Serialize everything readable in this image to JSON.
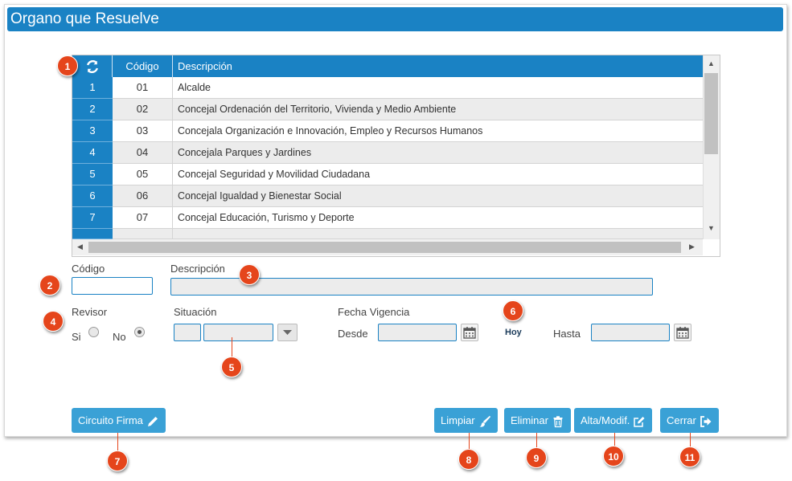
{
  "window": {
    "title": "Organo que Resuelve"
  },
  "grid": {
    "columns": {
      "refresh_icon": "refresh-icon",
      "code": "Código",
      "description": "Descripción"
    },
    "rows": [
      {
        "num": "1",
        "code": "01",
        "description": "Alcalde"
      },
      {
        "num": "2",
        "code": "02",
        "description": "Concejal Ordenación del Territorio, Vivienda y Medio Ambiente"
      },
      {
        "num": "3",
        "code": "03",
        "description": "Concejala Organización e Innovación, Empleo y Recursos Humanos"
      },
      {
        "num": "4",
        "code": "04",
        "description": "Concejala Parques y Jardines"
      },
      {
        "num": "5",
        "code": "05",
        "description": "Concejal Seguridad y Movilidad Ciudadana"
      },
      {
        "num": "6",
        "code": "06",
        "description": "Concejal Igualdad y Bienestar Social"
      },
      {
        "num": "7",
        "code": "07",
        "description": "Concejal Educación, Turismo y Deporte"
      }
    ]
  },
  "form": {
    "codigo_label": "Código",
    "codigo_value": "",
    "descripcion_label": "Descripción",
    "descripcion_value": "",
    "revisor_label": "Revisor",
    "revisor_si": "Si",
    "revisor_no": "No",
    "revisor_selected": "No",
    "situacion_label": "Situación",
    "fecha_vigencia_label": "Fecha Vigencia",
    "desde_label": "Desde",
    "hoy_label": "Hoy",
    "hasta_label": "Hasta"
  },
  "buttons": {
    "circuito_firma": "Circuito Firma",
    "limpiar": "Limpiar",
    "eliminar": "Eliminar",
    "alta_modif": "Alta/Modif.",
    "cerrar": "Cerrar"
  },
  "callouts": [
    "1",
    "2",
    "3",
    "4",
    "5",
    "6",
    "7",
    "8",
    "9",
    "10",
    "11"
  ],
  "colors": {
    "accent": "#1a82c4",
    "button": "#3aa1d6",
    "callout": "#e5451b"
  }
}
